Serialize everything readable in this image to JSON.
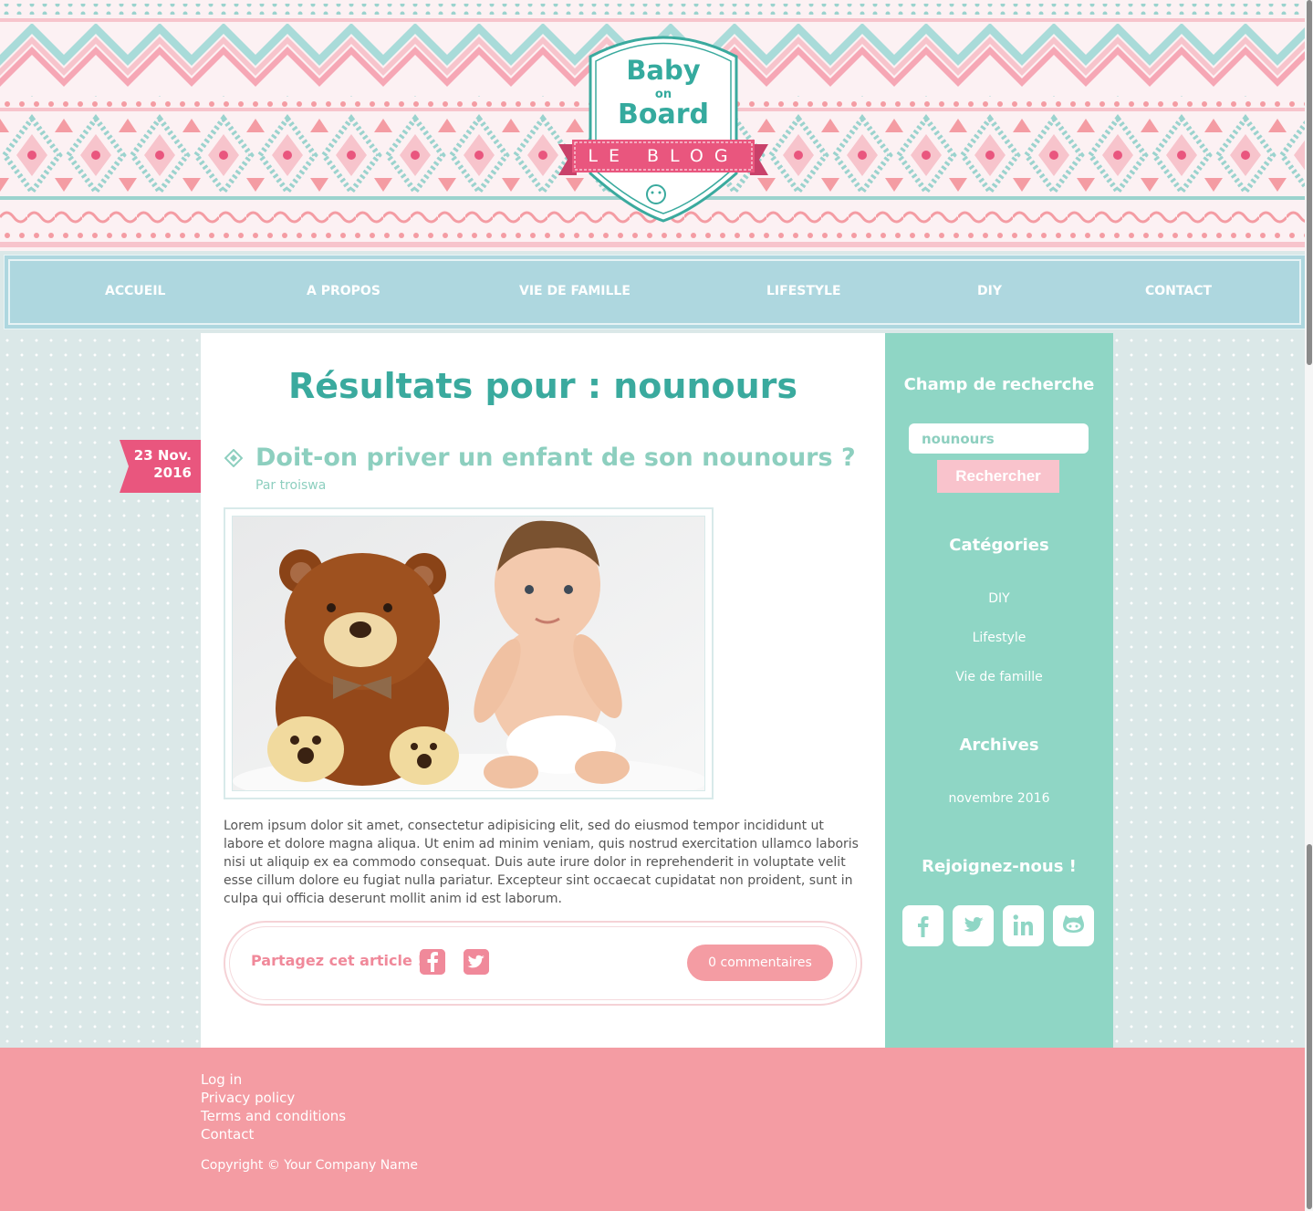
{
  "brand": {
    "logo_line1": "Baby",
    "logo_line2": "on",
    "logo_line3": "Board",
    "ribbon": "LE BLOG"
  },
  "nav": {
    "items": [
      "ACCUEIL",
      "A PROPOS",
      "VIE DE FAMILLE",
      "LIFESTYLE",
      "DIY",
      "CONTACT"
    ]
  },
  "main": {
    "results_title": "Résultats pour : nounours",
    "post": {
      "date_line1": "23 Nov.",
      "date_line2": "2016",
      "title": "Doit-on priver un enfant de son nounours ?",
      "author": "Par troiswa",
      "excerpt": "Lorem ipsum dolor sit amet, consectetur adipisicing elit, sed do eiusmod tempor incididunt ut labore et dolore magna aliqua. Ut enim ad minim veniam, quis nostrud exercitation ullamco laboris nisi ut aliquip ex ea commodo consequat. Duis aute irure dolor in reprehenderit in voluptate velit esse cillum dolore eu fugiat nulla pariatur. Excepteur sint occaecat cupidatat non proident, sunt in culpa qui officia deserunt mollit anim id est laborum.",
      "share_label": "Partagez cet article !",
      "comments_label": "0 commentaires",
      "image_icon": "teddy-bear-and-baby-photo"
    }
  },
  "sidebar": {
    "search_heading": "Champ de recherche",
    "search_value": "nounours",
    "search_button": "Rechercher",
    "categories_heading": "Catégories",
    "categories": [
      "DIY",
      "Lifestyle",
      "Vie de famille"
    ],
    "archives_heading": "Archives",
    "archives": [
      "novembre 2016"
    ],
    "social_heading": "Rejoignez-nous !",
    "social_icons": [
      "facebook-icon",
      "twitter-icon",
      "linkedin-icon",
      "github-icon"
    ]
  },
  "footer": {
    "links": [
      "Log in",
      "Privacy policy",
      "Terms and conditions",
      "Contact"
    ],
    "copyright": "Copyright © Your Company Name"
  },
  "colors": {
    "teal": "#3aaa9e",
    "mint": "#8fd6c5",
    "nav_blue": "#aed7df",
    "pink": "#f49ca3",
    "hot_pink": "#e9567e",
    "background": "#dbe8e8"
  }
}
